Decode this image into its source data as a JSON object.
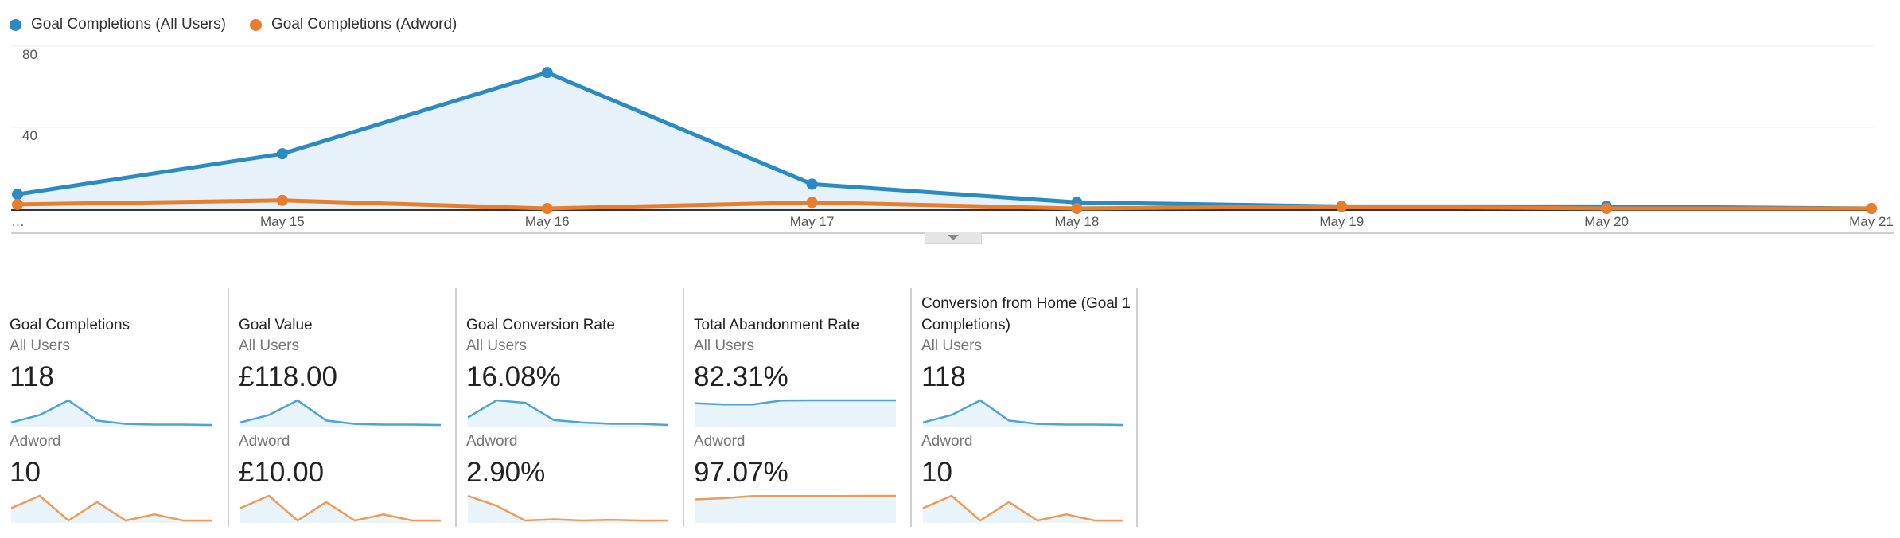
{
  "legend": [
    {
      "label": "Goal Completions (All Users)",
      "color": "#2a8ac4"
    },
    {
      "label": "Goal Completions (Adword)",
      "color": "#e87d2b"
    }
  ],
  "chart_data": {
    "type": "line",
    "categories": [
      "…",
      "May 15",
      "May 16",
      "May 17",
      "May 18",
      "May 19",
      "May 20",
      "May 21"
    ],
    "series": [
      {
        "name": "Goal Completions (All Users)",
        "color": "#2a8ac4",
        "values": [
          7,
          27,
          67,
          12,
          3,
          1,
          1,
          0
        ],
        "area": true
      },
      {
        "name": "Goal Completions (Adword)",
        "color": "#e87d2b",
        "values": [
          2,
          4,
          0,
          3,
          0,
          1,
          0,
          0
        ],
        "area": false
      }
    ],
    "y_ticks": [
      80,
      40
    ],
    "ylim": [
      0,
      80
    ],
    "grid": true
  },
  "scorecards": [
    {
      "title": "Goal Completions",
      "rows": [
        {
          "segment": "All Users",
          "value": "118",
          "trend": [
            7,
            27,
            67,
            12,
            3,
            1,
            1,
            0
          ]
        },
        {
          "segment": "Adword",
          "value": "10",
          "trend": [
            2,
            4,
            0,
            3,
            0,
            1,
            0,
            0
          ]
        }
      ]
    },
    {
      "title": "Goal Value",
      "rows": [
        {
          "segment": "All Users",
          "value": "£118.00",
          "trend": [
            7,
            27,
            67,
            12,
            3,
            1,
            1,
            0
          ]
        },
        {
          "segment": "Adword",
          "value": "£10.00",
          "trend": [
            2,
            4,
            0,
            3,
            0,
            1,
            0,
            0
          ]
        }
      ]
    },
    {
      "title": "Goal Conversion Rate",
      "rows": [
        {
          "segment": "All Users",
          "value": "16.08%",
          "trend": [
            3,
            10,
            9,
            2,
            1,
            0.5,
            0.5,
            0
          ]
        },
        {
          "segment": "Adword",
          "value": "2.90%",
          "trend": [
            10,
            6,
            0,
            0.5,
            0,
            0.3,
            0,
            0
          ]
        }
      ]
    },
    {
      "title": "Total Abandonment Rate",
      "rows": [
        {
          "segment": "All Users",
          "value": "82.31%",
          "trend": [
            78,
            74,
            74,
            88,
            89,
            89,
            89,
            89
          ]
        },
        {
          "segment": "Adword",
          "value": "97.07%",
          "trend": [
            85,
            90,
            99,
            99,
            99,
            99,
            99.5,
            99.5
          ]
        }
      ]
    },
    {
      "title": "Conversion from Home (Goal 1 Completions)",
      "rows": [
        {
          "segment": "All Users",
          "value": "118",
          "trend": [
            7,
            27,
            67,
            12,
            3,
            1,
            1,
            0
          ]
        },
        {
          "segment": "Adword",
          "value": "10",
          "trend": [
            2,
            4,
            0,
            3,
            0,
            1,
            0,
            0
          ]
        }
      ]
    }
  ]
}
